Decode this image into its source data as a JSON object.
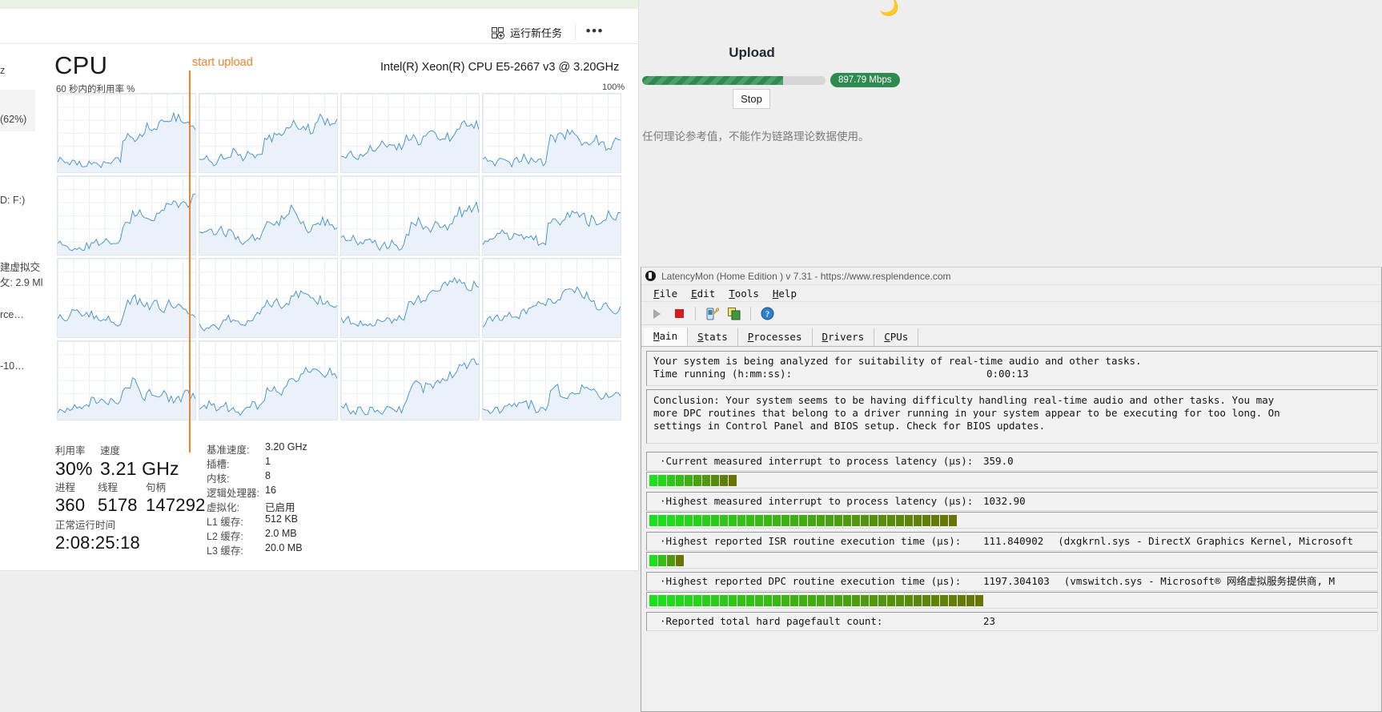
{
  "browser": {
    "moon_icon": "moon-icon",
    "upload": {
      "title": "Upload",
      "speed_badge": "897.79 Mbps",
      "progress_percent": 77,
      "stop_label": "Stop",
      "disclaimer": "任何理论参考值，不能作为链路理论数据使用。",
      "bar_color": "#2e8b50"
    }
  },
  "taskmgr": {
    "toolbar": {
      "new_task_label": "运行新任务",
      "new_task_icon": "new-task-icon",
      "more_label": "•••"
    },
    "sidebar": {
      "clipped_texts": [
        "z",
        "(62%)",
        "D: F:)",
        "建虚拟交",
        "攵: 2.9 Ml",
        "rce…",
        "-10…"
      ]
    },
    "cpu": {
      "title": "CPU",
      "model": "Intel(R) Xeon(R) CPU E5-2667 v3 @ 3.20GHz",
      "subtitle": "60 秒内的利用率 %",
      "axis_max": "100%",
      "marker_label": "start upload",
      "marker_color": "#f1822c"
    },
    "stats": {
      "utilization_label": "利用率",
      "utilization_value": "30%",
      "speed_label": "速度",
      "speed_value": "3.21 GHz",
      "processes_label": "进程",
      "processes_value": "360",
      "threads_label": "线程",
      "threads_value": "5178",
      "handles_label": "句柄",
      "handles_value": "147292",
      "uptime_label": "正常运行时间",
      "uptime_value": "2:08:25:18"
    },
    "specs": [
      {
        "key": "基准速度:",
        "value": "3.20 GHz"
      },
      {
        "key": "插槽:",
        "value": "1"
      },
      {
        "key": "内核:",
        "value": "8"
      },
      {
        "key": "逻辑处理器:",
        "value": "16"
      },
      {
        "key": "虚拟化:",
        "value": "已启用"
      },
      {
        "key": "L1 缓存:",
        "value": "512 KB"
      },
      {
        "key": "L2 缓存:",
        "value": "2.0 MB"
      },
      {
        "key": "L3 缓存:",
        "value": "20.0 MB"
      }
    ]
  },
  "latencymon": {
    "title": "LatencyMon  (Home Edition )  v 7.31 - https://www.resplendence.com",
    "menus": [
      "File",
      "Edit",
      "Tools",
      "Help"
    ],
    "toolbar_icons": [
      "play-icon",
      "stop-icon",
      "wizard-icon",
      "copy-icon",
      "help-icon"
    ],
    "tabs": [
      "Main",
      "Stats",
      "Processes",
      "Drivers",
      "CPUs"
    ],
    "active_tab": "Main",
    "status": {
      "line1": "Your system is being analyzed for suitability of real-time audio and other tasks.",
      "time_label": "Time running (h:mm:ss):",
      "time_value": "0:00:13"
    },
    "conclusion": [
      "Conclusion: Your system seems to be having difficulty handling real-time audio and other tasks. You may ",
      "more DPC routines that belong to a driver running in your system appear to be executing for too long. On",
      "settings in Control Panel and BIOS setup. Check for BIOS updates."
    ],
    "metrics": [
      {
        "label": "·Current measured interrupt to process latency (µs):",
        "value": "359.0",
        "note": "",
        "segments": 10
      },
      {
        "label": "·Highest measured interrupt to process latency (µs):",
        "value": "1032.90",
        "note": "",
        "segments": 35
      },
      {
        "label": "·Highest reported ISR routine execution time (µs):",
        "value": "111.840902",
        "note": "(dxgkrnl.sys - DirectX Graphics Kernel, Microsoft",
        "segments": 4
      },
      {
        "label": "·Highest reported DPC routine execution time (µs):",
        "value": "1197.304103",
        "note": "(vmswitch.sys - Microsoft® 网络虚拟服务提供商, M",
        "segments": 38
      },
      {
        "label": "·Reported total hard pagefault count:",
        "value": "23",
        "note": "",
        "segments": 0
      }
    ]
  }
}
